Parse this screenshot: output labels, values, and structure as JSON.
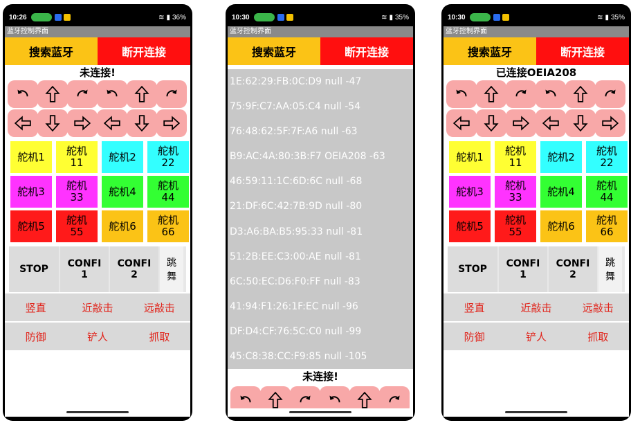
{
  "app_title": "蓝牙控制界面",
  "buttons": {
    "search": "搜索蓝牙",
    "disconnect": "断开连接"
  },
  "phones": [
    {
      "time": "10:26",
      "battery": "36%",
      "status_text": "未连接!"
    },
    {
      "time": "10:30",
      "battery": "35%",
      "status_text": "未连接!"
    },
    {
      "time": "10:30",
      "battery": "35%",
      "status_text": "已连接OEIA208"
    }
  ],
  "servos": [
    {
      "label": "舵机1",
      "color": "#ffff33"
    },
    {
      "label": "舵机\n11",
      "color": "#ffff33"
    },
    {
      "label": "舵机2",
      "color": "#33ffff"
    },
    {
      "label": "舵机\n22",
      "color": "#33ffff"
    },
    {
      "label": "舵机3",
      "color": "#ff33ff"
    },
    {
      "label": "舵机\n33",
      "color": "#ff33ff"
    },
    {
      "label": "舵机4",
      "color": "#33ff33"
    },
    {
      "label": "舵机\n44",
      "color": "#33ff33"
    },
    {
      "label": "舵机5",
      "color": "#ff1a1a"
    },
    {
      "label": "舵机\n55",
      "color": "#ff1a1a"
    },
    {
      "label": "舵机6",
      "color": "#fbc316"
    },
    {
      "label": "舵机\n66",
      "color": "#fbc316"
    }
  ],
  "controls": {
    "stop": "STOP",
    "config1": "CONFI\n1",
    "config2": "CONFI\n2",
    "dance": "跳\n舞"
  },
  "actions": [
    "竖直",
    "近敲击",
    "远敲击",
    "防御",
    "铲人",
    "抓取"
  ],
  "devices": [
    "1E:62:29:FB:0C:D9 null -47",
    "75:9F:C7:AA:05:C4 null -54",
    "76:48:62:5F:7F:A6 null -63",
    "B9:AC:4A:80:3B:F7 OEIA208 -63",
    "46:59:11:1C:6D:6C null -68",
    "21:DF:6C:42:7B:9D null -80",
    "D3:A6:BA:B5:95:33 null -81",
    "51:2B:EE:C3:00:AE null -81",
    "6C:50:EC:D6:F0:FF null -83",
    "41:94:F1:26:1F:EC null -96",
    "DF:D4:CF:76:5C:C0 null -99",
    "45:C8:38:CC:F9:85 null -105"
  ],
  "arrow_icons": [
    "rotate-left-icon",
    "arrow-up-icon",
    "rotate-right-icon",
    "rotate-left-icon",
    "arrow-up-icon",
    "rotate-right-icon",
    "arrow-left-icon",
    "arrow-down-icon",
    "arrow-right-icon",
    "arrow-left-icon",
    "arrow-down-icon",
    "arrow-right-icon"
  ]
}
